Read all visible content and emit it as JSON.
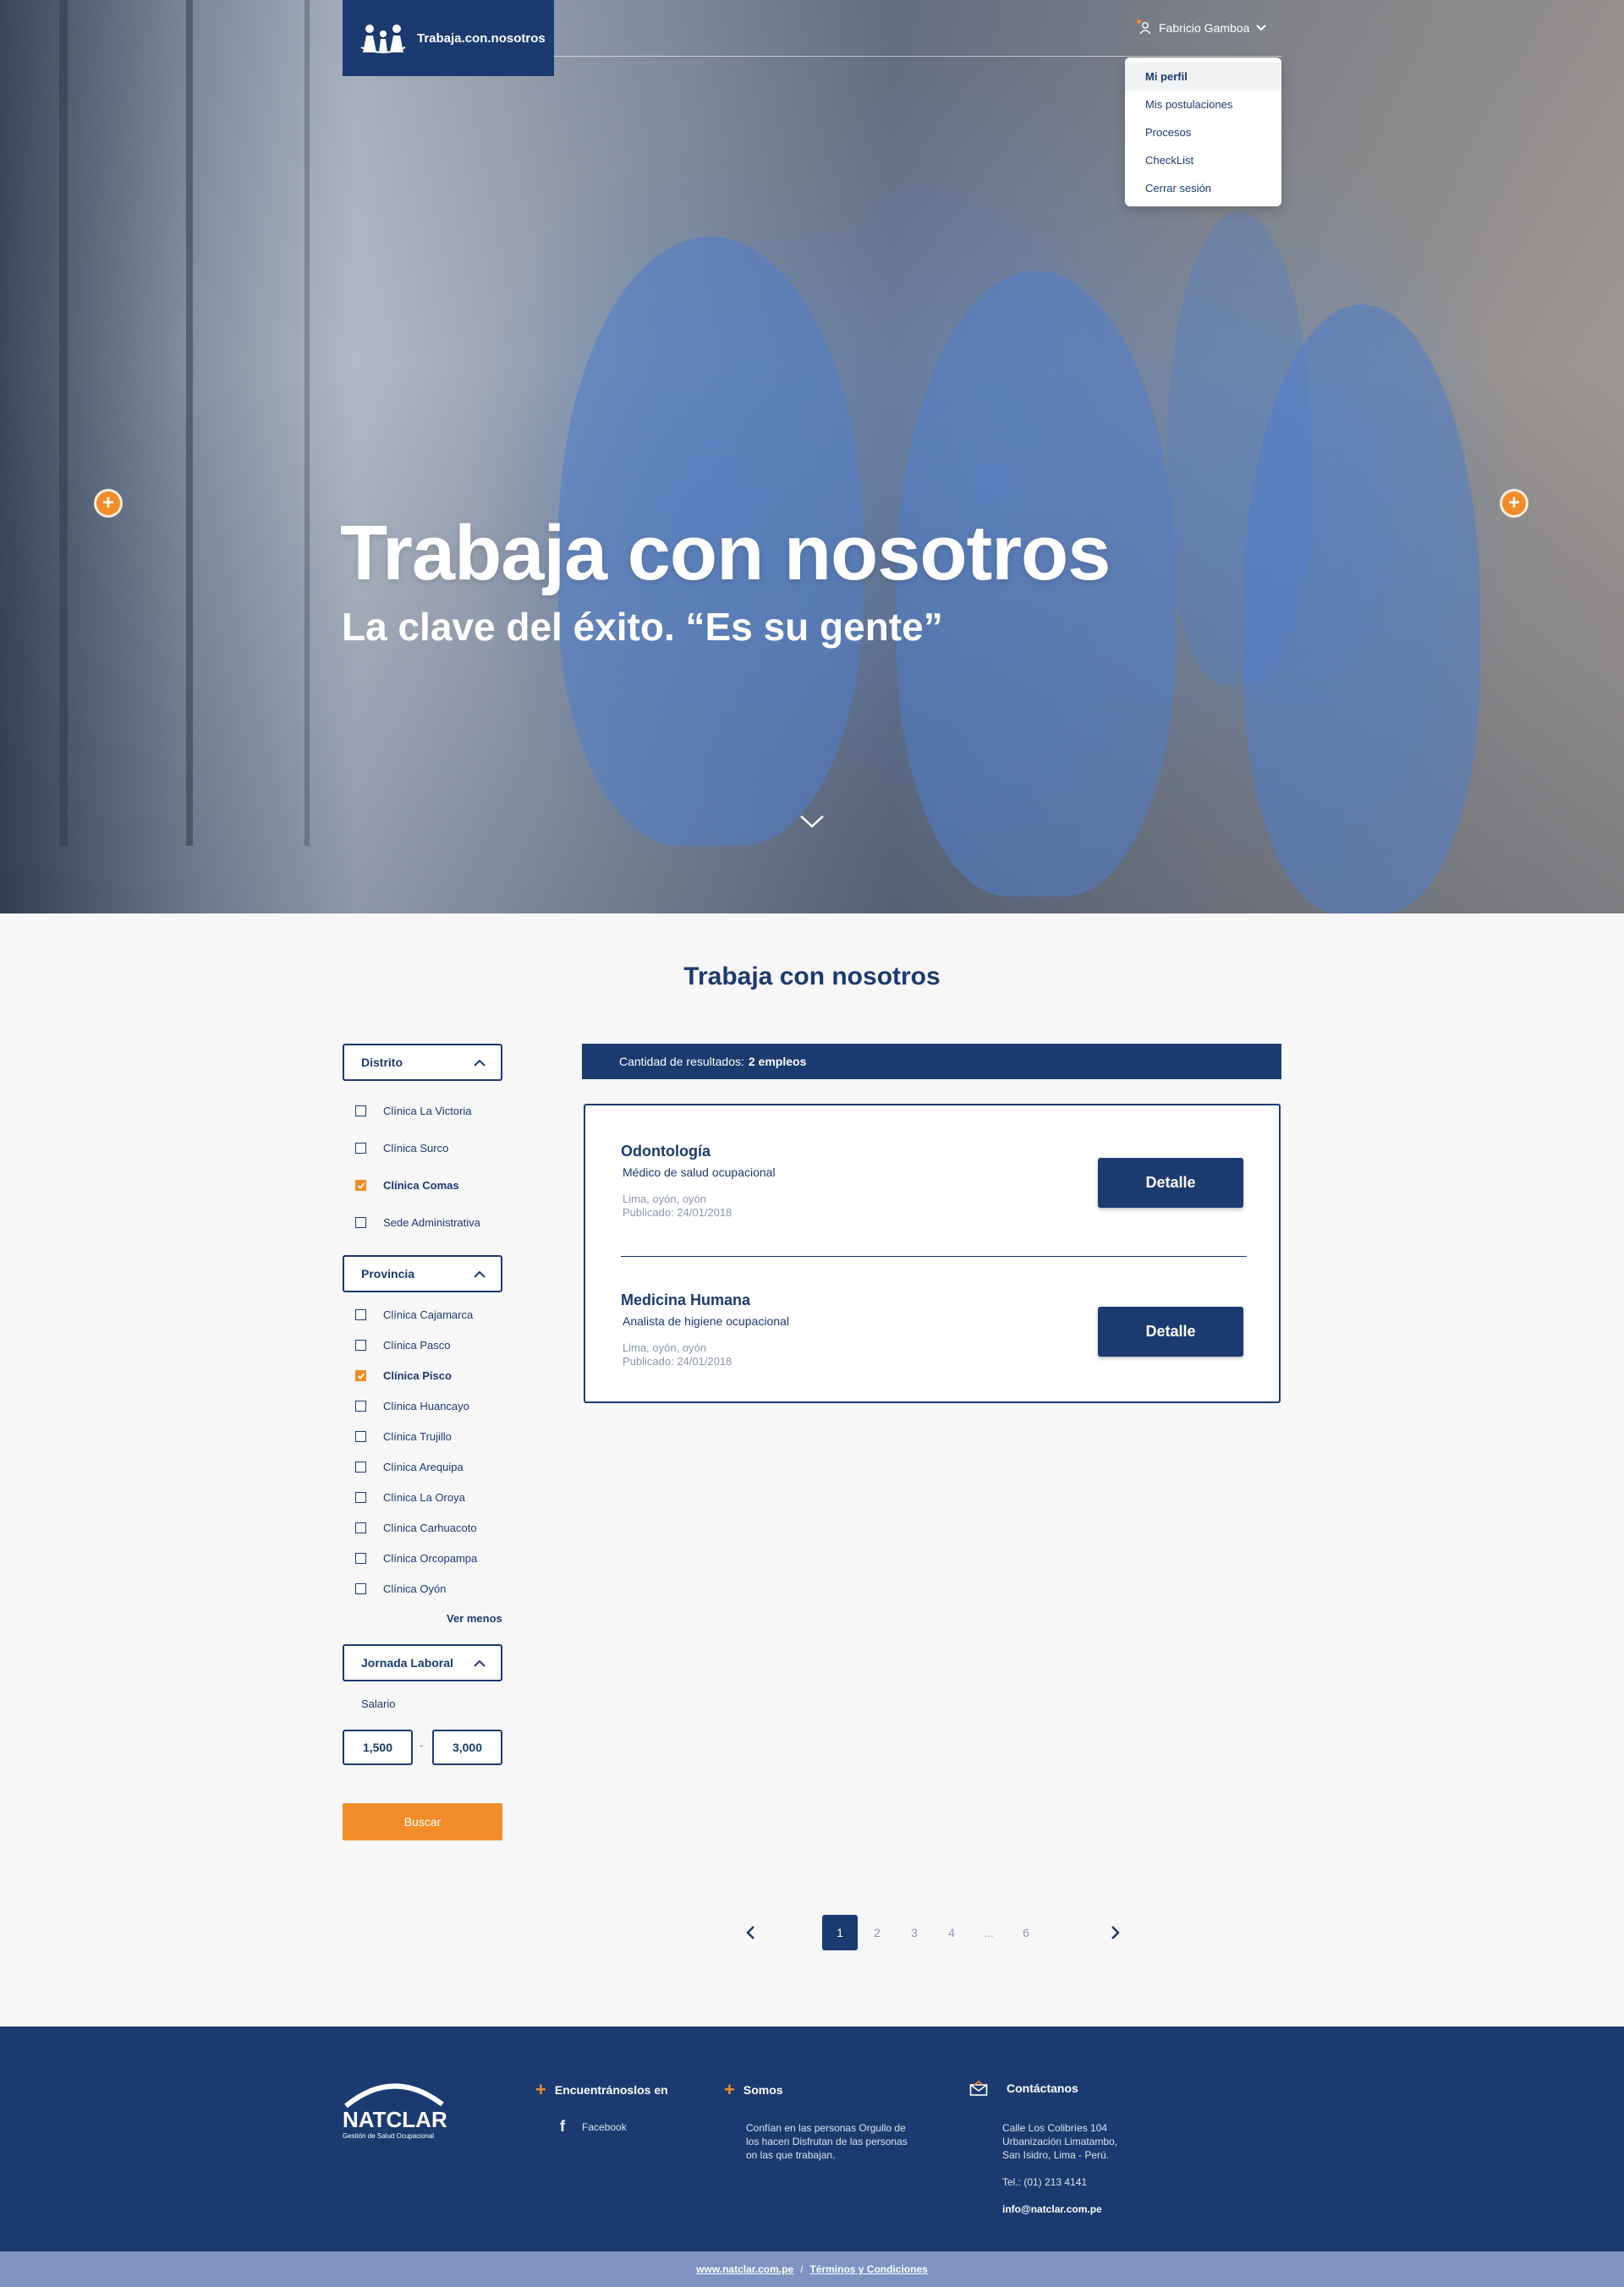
{
  "header": {
    "brand_label": "Trabaja.con.nosotros",
    "user_name": "Fabricio Gamboa",
    "menu_items": [
      "Mi perfil",
      "Mis postulaciones",
      "Procesos",
      "CheckList",
      "Cerrar sesión"
    ]
  },
  "hero": {
    "title": "Trabaja con nosotros",
    "subtitle": "La clave del éxito. “Es su gente”"
  },
  "section": {
    "title": "Trabaja con nosotros"
  },
  "filters": {
    "distrito": {
      "label": "Distrito",
      "options": [
        {
          "label": "Clínica La Victoria",
          "checked": false
        },
        {
          "label": "Clínica Surco",
          "checked": false
        },
        {
          "label": "Clínica Comas",
          "checked": true
        },
        {
          "label": "Sede Administrativa",
          "checked": false
        }
      ]
    },
    "provincia": {
      "label": "Provincia",
      "options": [
        {
          "label": "Clínica Cajamarca",
          "checked": false
        },
        {
          "label": "Clínica Pasco",
          "checked": false
        },
        {
          "label": "Clínica Pisco",
          "checked": true
        },
        {
          "label": "Clínica Huancayo",
          "checked": false
        },
        {
          "label": "Clínica Trujillo",
          "checked": false
        },
        {
          "label": "Clínica Arequipa",
          "checked": false
        },
        {
          "label": "Clínica La Oroya",
          "checked": false
        },
        {
          "label": "Clínica Carhuacoto",
          "checked": false
        },
        {
          "label": "Clínica Orcopampa",
          "checked": false
        },
        {
          "label": "Clínica Oyón",
          "checked": false
        }
      ],
      "ver_menos": "Ver menos"
    },
    "jornada": {
      "label": "Jornada Laboral"
    },
    "salario": {
      "label": "Salario",
      "min": "1,500",
      "max": "3,000",
      "separator": "-"
    },
    "buscar": "Buscar"
  },
  "results": {
    "count_label": "Cantidad de resultados:",
    "count_value": "2 empleos",
    "jobs": [
      {
        "title": "Odontología",
        "position": "Médico de salud ocupacional",
        "location": "Lima, oyón, oyón",
        "published": "Publicado: 24/01/2018",
        "button": "Detalle"
      },
      {
        "title": "Medicina Humana",
        "position": "Analista de higiene ocupacional",
        "location": "Lima, oyón, oyón",
        "published": "Publicado: 24/01/2018",
        "button": "Detalle"
      }
    ]
  },
  "pagination": {
    "pages": [
      "1",
      "2",
      "3",
      "4",
      "...",
      "6"
    ],
    "current": "1"
  },
  "footer": {
    "logo_text": "NATCLAR",
    "logo_tagline": "Gestión de Salud Ocupacional",
    "find_us": {
      "title": "Encuentránoslos en",
      "facebook": "Facebook"
    },
    "somos": {
      "title": "Somos",
      "text": "Confían en las personas Orgullo de los hacen Disfrutan de las personas on las que trabajan."
    },
    "contact": {
      "title": "Contáctanos",
      "address_1": "Calle Los Colibríes 104",
      "address_2": "Urbanización Limatambo,",
      "address_3": "San Isidro, Lima - Perú.",
      "phone": "Tel.: (01) 213 4141",
      "email": "info@natclar.com.pe"
    },
    "bottom": {
      "site": "www.natclar.com.pe",
      "separator": "/",
      "terms": "Términos y Condiciones"
    }
  },
  "colors": {
    "navy": "#1b3a6f",
    "orange": "#f28c28",
    "light_blue": "#7e93c2"
  }
}
